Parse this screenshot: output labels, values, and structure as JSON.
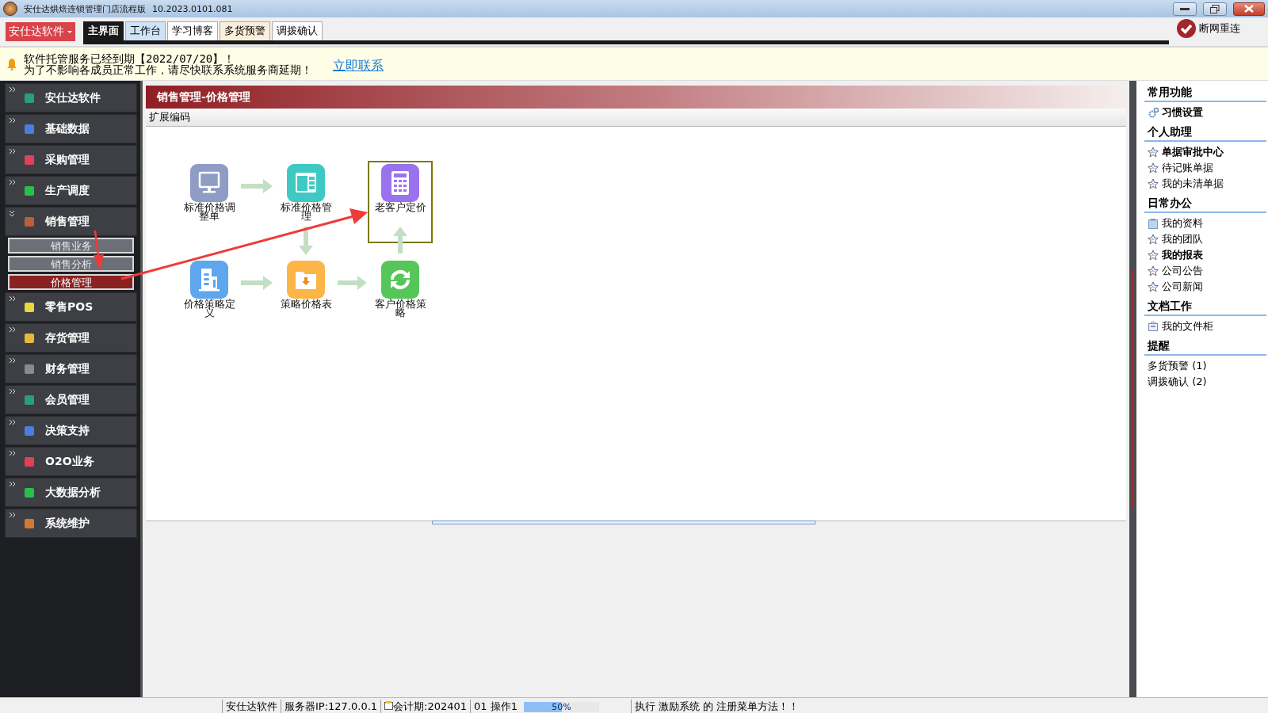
{
  "window": {
    "title": "安仕达烘焙连锁管理门店流程版",
    "version": "10.2023.0101.081"
  },
  "toolbar": {
    "menu_button": "安仕达软件",
    "tabs": [
      {
        "label": "主界面",
        "selected": true
      },
      {
        "label": "工作台",
        "selected": false,
        "color": "#cfe3f7"
      },
      {
        "label": "学习博客",
        "selected": false,
        "color": "#ffffff"
      },
      {
        "label": "多货预警",
        "selected": false,
        "color": "#fbeedb"
      },
      {
        "label": "调拨确认",
        "selected": false,
        "color": "#ffffff"
      }
    ],
    "reconnect": "断网重连"
  },
  "notice": {
    "line1": "软件托管服务已经到期【2022/07/20】！",
    "line2": "为了不影响各成员正常工作，请尽快联系系统服务商延期！",
    "link": "立即联系"
  },
  "sidebar": {
    "items": [
      {
        "label": "安仕达软件",
        "color": "#2a9d7c",
        "expanded": false
      },
      {
        "label": "基础数据",
        "color": "#4a7fe0",
        "expanded": false
      },
      {
        "label": "采购管理",
        "color": "#e0405a",
        "expanded": false
      },
      {
        "label": "生产调度",
        "color": "#27c04a",
        "expanded": false
      },
      {
        "label": "销售管理",
        "color": "#b8603a",
        "expanded": true,
        "children": [
          {
            "label": "销售业务",
            "selected": false
          },
          {
            "label": "销售分析",
            "selected": false
          },
          {
            "label": "价格管理",
            "selected": true
          }
        ]
      },
      {
        "label": "零售POS",
        "color": "#e8d83a",
        "expanded": false
      },
      {
        "label": "存货管理",
        "color": "#e8b83a",
        "expanded": false
      },
      {
        "label": "财务管理",
        "color": "#8a8a8a",
        "expanded": false
      },
      {
        "label": "会员管理",
        "color": "#2a9d7c",
        "expanded": false
      },
      {
        "label": "决策支持",
        "color": "#4a7fe0",
        "expanded": false
      },
      {
        "label": "O2O业务",
        "color": "#e0405a",
        "expanded": false
      },
      {
        "label": "大数据分析",
        "color": "#27c04a",
        "expanded": false
      },
      {
        "label": "系统维护",
        "color": "#d07a3a",
        "expanded": false
      }
    ]
  },
  "content": {
    "title": "销售管理-价格管理",
    "toolbar_label": "扩展编码",
    "flow_nodes": [
      {
        "label": "标准价格调整单",
        "kind": "monitor",
        "color": "#8f9cc4",
        "highlighted": false
      },
      {
        "label": "标准价格管理",
        "kind": "panel",
        "color": "#3ec9c4",
        "highlighted": false
      },
      {
        "label": "老客户定价",
        "kind": "calculator",
        "color": "#9a72ee",
        "highlighted": true
      },
      {
        "label": "价格策略定义",
        "kind": "building",
        "color": "#5ea6ee",
        "highlighted": false
      },
      {
        "label": "策略价格表",
        "kind": "folder",
        "color": "#fdb548",
        "highlighted": false
      },
      {
        "label": "客户价格策略",
        "kind": "refresh",
        "color": "#56c65a",
        "highlighted": false
      }
    ]
  },
  "right_panel": {
    "sections": [
      {
        "heading": "常用功能",
        "items": [
          {
            "label": "习惯设置",
            "kind": "gear",
            "bold": true
          }
        ]
      },
      {
        "heading": "个人助理",
        "items": [
          {
            "label": "单据审批中心",
            "kind": "star",
            "bold": true
          },
          {
            "label": "待记账单据",
            "kind": "star",
            "bold": false
          },
          {
            "label": "我的未清单据",
            "kind": "star",
            "bold": false
          }
        ]
      },
      {
        "heading": "日常办公",
        "items": [
          {
            "label": "我的资料",
            "kind": "notepad",
            "bold": false
          },
          {
            "label": "我的团队",
            "kind": "star",
            "bold": false
          },
          {
            "label": "我的报表",
            "kind": "star",
            "bold": true
          },
          {
            "label": "公司公告",
            "kind": "star",
            "bold": false
          },
          {
            "label": "公司新闻",
            "kind": "star",
            "bold": false
          }
        ]
      },
      {
        "heading": "文档工作",
        "items": [
          {
            "label": "我的文件柜",
            "kind": "cabinet",
            "bold": false
          }
        ]
      },
      {
        "heading": "提醒",
        "items": [
          {
            "label": "多货预警 (1)",
            "kind": "plain",
            "bold": false
          },
          {
            "label": "调拨确认 (2)",
            "kind": "plain",
            "bold": false
          }
        ]
      }
    ]
  },
  "status_bar": {
    "company": "安仕达软件",
    "server": "服务器IP:127.0.0.1",
    "period": "会计期:202401",
    "operator": "01 操作1",
    "progress": {
      "level": 0.5,
      "reading": "50%"
    },
    "message": "执行 激励系统 的 注册菜单方法！！"
  }
}
